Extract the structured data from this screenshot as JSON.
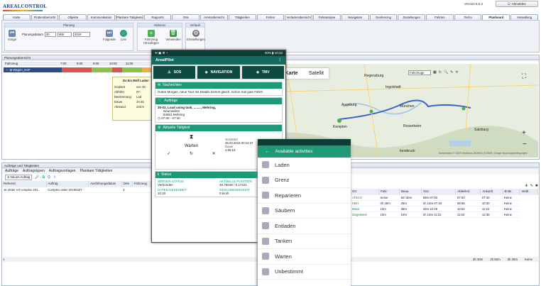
{
  "app": {
    "logo": "AREALCONTROL",
    "version": "Version 5.6.3",
    "logout_label": "Abmelden"
  },
  "tabs": [
    "Karte",
    "Flottenübersicht",
    "Objekte",
    "Kommunikation",
    "Planbare Tätigkeiten",
    "Rapports",
    "Orte",
    "Arretsübersicht",
    "Tätigkeiten",
    "Fahrer",
    "Verladenübersicht",
    "Fahranalyse",
    "Navigation",
    "Geofencing",
    "Zustellungen",
    "Fahrten",
    "Techo",
    "Planboard",
    "Verwaltung"
  ],
  "ribbon": {
    "planning": {
      "title": "Planung",
      "date_label": "Planungsdatum",
      "day": "30",
      "month": "Mär",
      "year": "2019",
      "prev": "Vorige",
      "next": "Folgende",
      "live": "Live"
    },
    "actions": {
      "title": "Aktionen",
      "add": "Fahrzeug Hinzufügen",
      "remove": "Verwenden"
    },
    "default": {
      "title": "Default",
      "settings": "Einstellungen"
    }
  },
  "planning_overview": {
    "title": "Planungsübersicht",
    "col": "Fahrzeug",
    "times": [
      "7:00",
      "8:00",
      "9:00",
      "10:00",
      "11:00",
      "12:00"
    ],
    "vehicle": "--- ⊕ Wagen_test*"
  },
  "popup": {
    "title": "Da bis Mofl Laden",
    "rows": [
      {
        "k": "Geplant",
        "v": "von 30"
      },
      {
        "k": "Abfahrt",
        "v": "07:"
      },
      {
        "k": "Bestimmung",
        "v": "Lad"
      },
      {
        "k": "Dauer",
        "v": "34:45"
      },
      {
        "k": "Abstand",
        "v": "233.5"
      }
    ]
  },
  "map": {
    "tab1": "Karte",
    "tab2": "Satellit",
    "dropdown": "Fahrzeuge",
    "cities": [
      "München",
      "Rosenheim",
      "Salzburg",
      "Kempten",
      "Regensburg",
      "Augsburg",
      "Ingolstadt",
      "Innsbruck"
    ],
    "attribution": "Kartendaten © 2019 GeoBasis-DE/BKG (©2009), Google  Nutzungsbedingungen"
  },
  "phone": {
    "status_time": "10:22",
    "battery": "40%",
    "app_title": "ArealPilot",
    "nav": [
      "SOS",
      "NAVIGATION",
      "TMV"
    ],
    "messages": {
      "title": "Nachrichten",
      "text": "Guten Morgen, neue Tour mit Details kommt gleich. Schon mal gute Fahrt!"
    },
    "orders": {
      "title": "Aufträge",
      "line1": "30-03, Load using task, ........, Mehring,",
      "street": "Neumarkter",
      "city": "84561 Mehring",
      "time": "07:00 - 07:30"
    },
    "current": {
      "title": "Aktuelle Tätigkeit",
      "state": "Warten",
      "started_label": "Gestartet",
      "started": "29.03.2019 00:24:37",
      "duration_label": "Dauer",
      "duration": "1:58:19"
    },
    "status": {
      "title": "Status",
      "server_label": "SERVER-STATUS",
      "server": "Verbunden",
      "pos_label": "AKTUELLE POSITION",
      "pos": "48.76548 / 9.17221",
      "sent_label": "DATEN GESENDET",
      "sent": "10:20",
      "speed_label": "GESCHWINDIGKEIT",
      "speed": "0 km/h"
    }
  },
  "activities": {
    "title": "Available activities",
    "items": [
      "Laden",
      "Grenz",
      "Reparieren",
      "Säubern",
      "Entladen",
      "Tanken",
      "Warten",
      "Unbestimmt"
    ]
  },
  "orders_panel": {
    "title": "Aufträge und Tätigkeiten",
    "tabs": [
      "Aufträge",
      "Auftragstypen",
      "Auftragsvorlagen",
      "Planbare Tätigkeiten"
    ],
    "new": "Neuen Auftrag",
    "columns": [
      "Referenz",
      "Auftrag",
      "Ausführungsdatum",
      "Orte",
      "Fahrzeug"
    ],
    "rows": [
      [
        "Je Order ref complex 201..",
        "Complex order 20190327",
        "",
        "3",
        ""
      ]
    ]
  },
  "stops_table": {
    "columns": [
      "Ort",
      "Fahr.",
      "Beau.",
      "Gez.",
      "Ablieferd",
      "Ankunft",
      "Ende",
      "Verbl."
    ],
    "rows": [
      [
        "ATECH",
        "Keine",
        "5m 30m",
        "59m 07:00",
        "07:00",
        "07:30",
        "Keine"
      ],
      [
        "KBH",
        "2h 45m",
        "25m",
        "1h 15m 07:33",
        "08:55",
        "10:30",
        "Keine"
      ],
      [
        "Macit",
        "10m",
        "38m",
        "43m 10:49",
        "10:62",
        "11:22",
        "Keine"
      ],
      [
        "Ziegelwerk",
        "10m",
        "10m",
        "1h 15m 11:22",
        "11:53",
        "12:36",
        "Keine"
      ]
    ],
    "totals": [
      "3h 30m",
      "2h 50m",
      "3h 30m",
      "Keine"
    ],
    "footer_count": "1"
  }
}
